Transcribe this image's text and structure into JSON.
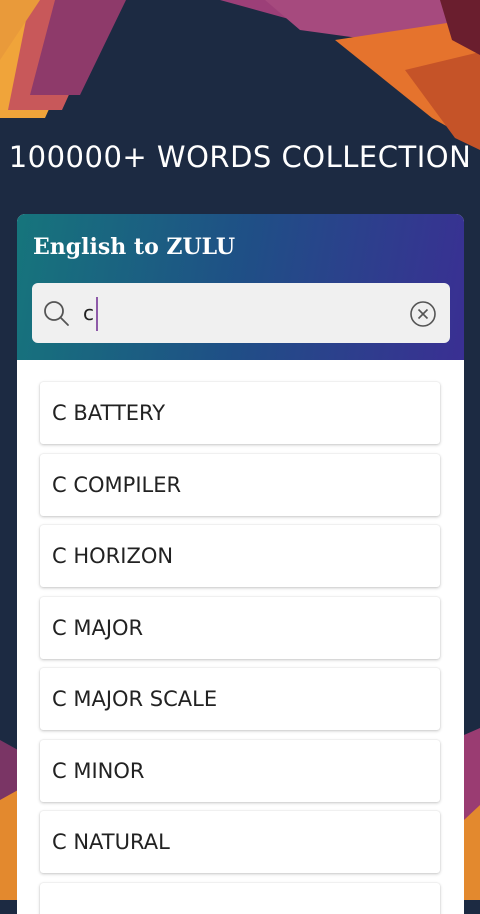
{
  "headline": "100000+ WORDS COLLECTION",
  "card": {
    "title": "English to ZULU",
    "search": {
      "value": "c"
    }
  },
  "words": [
    "C BATTERY",
    "C COMPILER",
    "C HORIZON",
    "C MAJOR",
    "C MAJOR SCALE",
    "C MINOR",
    "C NATURAL",
    ""
  ],
  "colors": {
    "background": "#1c2a42",
    "header_gradient": [
      "#16757c",
      "#1f4f86",
      "#3a2f93"
    ],
    "caret": "#8e5aa8"
  }
}
